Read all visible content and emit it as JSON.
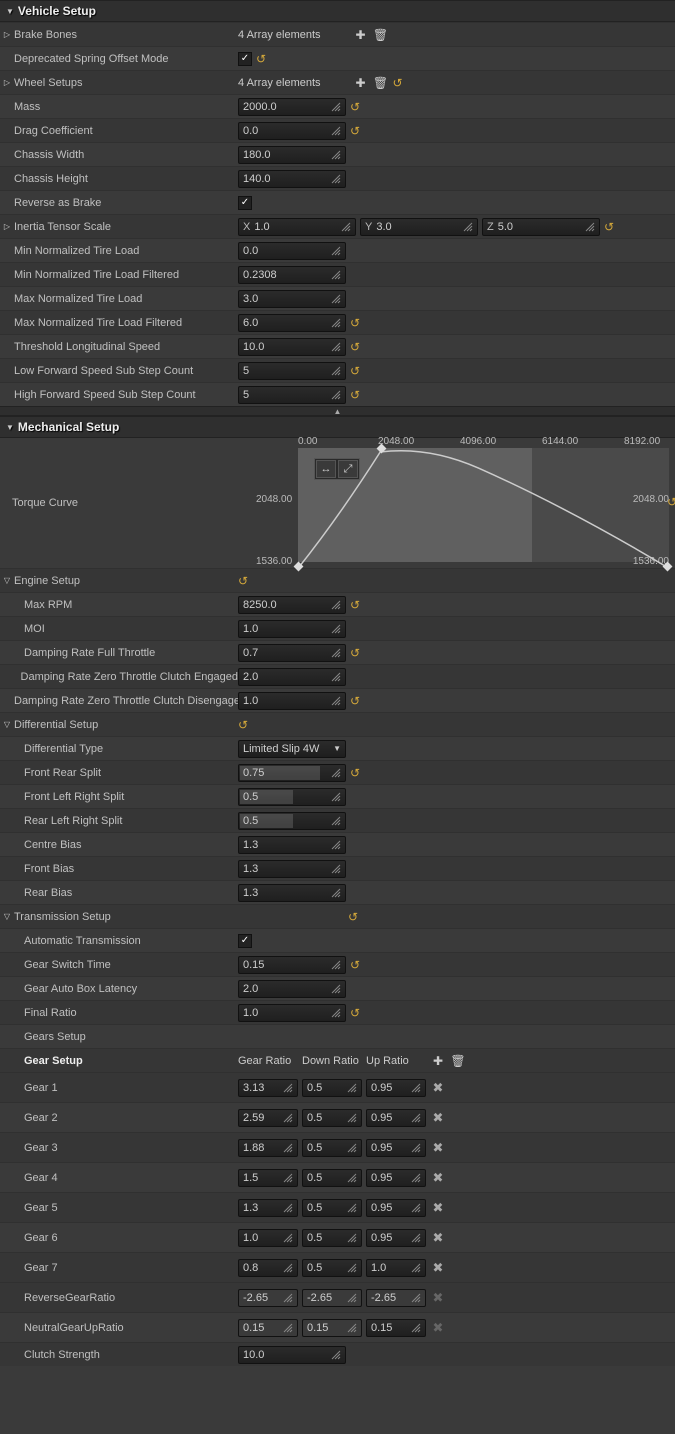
{
  "sections": {
    "vehicle_setup": "Vehicle Setup",
    "mechanical_setup": "Mechanical Setup"
  },
  "vehicle": {
    "brake_bones": {
      "label": "Brake Bones",
      "value": "4 Array elements"
    },
    "deprecated_spring": {
      "label": "Deprecated Spring Offset Mode",
      "checked": true,
      "reset": true
    },
    "wheel_setups": {
      "label": "Wheel Setups",
      "value": "4 Array elements",
      "reset": true
    },
    "mass": {
      "label": "Mass",
      "value": "2000.0",
      "reset": true
    },
    "drag": {
      "label": "Drag Coefficient",
      "value": "0.0",
      "reset": true
    },
    "chassis_w": {
      "label": "Chassis Width",
      "value": "180.0"
    },
    "chassis_h": {
      "label": "Chassis Height",
      "value": "140.0"
    },
    "reverse_brake": {
      "label": "Reverse as Brake",
      "checked": true
    },
    "inertia": {
      "label": "Inertia Tensor Scale",
      "x": "1.0",
      "y": "3.0",
      "z": "5.0",
      "reset": true
    },
    "min_tire": {
      "label": "Min Normalized Tire Load",
      "value": "0.0"
    },
    "min_tire_f": {
      "label": "Min Normalized Tire Load Filtered",
      "value": "0.2308"
    },
    "max_tire": {
      "label": "Max Normalized Tire Load",
      "value": "3.0"
    },
    "max_tire_f": {
      "label": "Max Normalized Tire Load Filtered",
      "value": "6.0",
      "reset": true
    },
    "thresh_long": {
      "label": "Threshold Longitudinal Speed",
      "value": "10.0",
      "reset": true
    },
    "low_fwd": {
      "label": "Low Forward Speed Sub Step Count",
      "value": "5",
      "reset": true
    },
    "high_fwd": {
      "label": "High Forward Speed Sub Step Count",
      "value": "5",
      "reset": true
    }
  },
  "mech": {
    "torque_label": "Torque Curve",
    "engine_setup": {
      "label": "Engine Setup",
      "reset": true
    },
    "max_rpm": {
      "label": "Max RPM",
      "value": "8250.0",
      "reset": true
    },
    "moi": {
      "label": "MOI",
      "value": "1.0"
    },
    "damp_full": {
      "label": "Damping Rate Full Throttle",
      "value": "0.7",
      "reset": true
    },
    "damp_z_eng": {
      "label": "Damping Rate Zero Throttle Clutch Engaged",
      "value": "2.0"
    },
    "damp_z_dis": {
      "label": "Damping Rate Zero Throttle Clutch Disengaged",
      "value": "1.0",
      "reset": true
    },
    "diff_setup": {
      "label": "Differential Setup",
      "reset": true
    },
    "diff_type": {
      "label": "Differential Type",
      "value": "Limited Slip 4W"
    },
    "front_rear": {
      "label": "Front Rear Split",
      "value": "0.75",
      "reset": true,
      "fill": 0.75
    },
    "flr": {
      "label": "Front Left Right Split",
      "value": "0.5",
      "fill": 0.5
    },
    "rlr": {
      "label": "Rear Left Right Split",
      "value": "0.5",
      "fill": 0.5
    },
    "centre_bias": {
      "label": "Centre Bias",
      "value": "1.3"
    },
    "front_bias": {
      "label": "Front Bias",
      "value": "1.3"
    },
    "rear_bias": {
      "label": "Rear Bias",
      "value": "1.3"
    },
    "trans_setup": {
      "label": "Transmission Setup",
      "reset": true
    },
    "auto_trans": {
      "label": "Automatic Transmission",
      "checked": true
    },
    "gear_switch": {
      "label": "Gear Switch Time",
      "value": "0.15",
      "reset": true
    },
    "gear_latency": {
      "label": "Gear Auto Box Latency",
      "value": "2.0"
    },
    "final_ratio": {
      "label": "Final Ratio",
      "value": "1.0",
      "reset": true
    },
    "gears_setup": {
      "label": "Gears Setup"
    },
    "gear_head": {
      "label": "Gear Setup",
      "c1": "Gear Ratio",
      "c2": "Down Ratio",
      "c3": "Up Ratio"
    },
    "gears": [
      {
        "name": "Gear 1",
        "r": "3.13",
        "d": "0.5",
        "u": "0.95"
      },
      {
        "name": "Gear 2",
        "r": "2.59",
        "d": "0.5",
        "u": "0.95"
      },
      {
        "name": "Gear 3",
        "r": "1.88",
        "d": "0.5",
        "u": "0.95"
      },
      {
        "name": "Gear 4",
        "r": "1.5",
        "d": "0.5",
        "u": "0.95"
      },
      {
        "name": "Gear 5",
        "r": "1.3",
        "d": "0.5",
        "u": "0.95"
      },
      {
        "name": "Gear 6",
        "r": "1.0",
        "d": "0.5",
        "u": "0.95"
      },
      {
        "name": "Gear 7",
        "r": "0.8",
        "d": "0.5",
        "u": "1.0"
      }
    ],
    "reverse": {
      "label": "ReverseGearRatio",
      "r": "-2.65",
      "d": "-2.65",
      "u": "-2.65"
    },
    "neutral": {
      "label": "NeutralGearUpRatio",
      "r": "0.15",
      "d": "0.15",
      "u": "0.15"
    },
    "clutch": {
      "label": "Clutch Strength",
      "value": "10.0"
    }
  },
  "chart_data": {
    "type": "line",
    "title": "Torque Curve",
    "xlabel": "",
    "ylabel": "",
    "x_ticks": [
      "0.00",
      "2048.00",
      "4096.00",
      "6144.00",
      "8192.00"
    ],
    "y_ticks_left": [
      "2048.00",
      "1536.00"
    ],
    "y_ticks_right": [
      "2048.00",
      "1536.00"
    ],
    "xlim": [
      0,
      8192
    ],
    "ylim": [
      1536,
      2100
    ],
    "series": [
      {
        "name": "torque",
        "x": [
          0,
          2048,
          4096,
          6144,
          8192
        ],
        "y": [
          1536,
          2100,
          2048,
          1850,
          1536
        ]
      }
    ],
    "reset": true
  }
}
